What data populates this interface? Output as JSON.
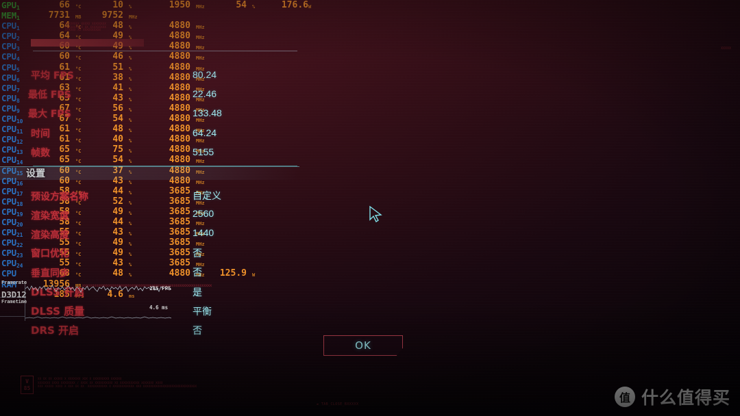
{
  "osd": {
    "rows": [
      {
        "label": "GPU",
        "sub": "1",
        "cells": [
          {
            "v": "66",
            "u": "°C"
          },
          {
            "v": "10",
            "u": "%"
          },
          {
            "v": "1950",
            "u": "MHz"
          },
          {
            "v": "54",
            "u": "%"
          },
          {
            "v": "176.6",
            "u": "W"
          }
        ]
      },
      {
        "label": "MEM",
        "sub": "1",
        "cells": [
          {
            "v": "7731",
            "u": "MB"
          },
          {
            "v": "9752",
            "u": "MHz"
          }
        ]
      },
      {
        "label": "CPU",
        "sub": "1",
        "cells": [
          {
            "v": "64",
            "u": "°C"
          },
          {
            "v": "48",
            "u": "%"
          },
          {
            "v": "4880",
            "u": "MHz"
          }
        ]
      },
      {
        "label": "CPU",
        "sub": "2",
        "cells": [
          {
            "v": "64",
            "u": "°C"
          },
          {
            "v": "49",
            "u": "%"
          },
          {
            "v": "4880",
            "u": "MHz"
          }
        ]
      },
      {
        "label": "CPU",
        "sub": "3",
        "cells": [
          {
            "v": "60",
            "u": "°C"
          },
          {
            "v": "49",
            "u": "%"
          },
          {
            "v": "4880",
            "u": "MHz"
          }
        ]
      },
      {
        "label": "CPU",
        "sub": "4",
        "cells": [
          {
            "v": "60",
            "u": "°C"
          },
          {
            "v": "46",
            "u": "%"
          },
          {
            "v": "4880",
            "u": "MHz"
          }
        ]
      },
      {
        "label": "CPU",
        "sub": "5",
        "cells": [
          {
            "v": "61",
            "u": "°C"
          },
          {
            "v": "51",
            "u": "%"
          },
          {
            "v": "4880",
            "u": "MHz"
          }
        ]
      },
      {
        "label": "CPU",
        "sub": "6",
        "cells": [
          {
            "v": "61",
            "u": "°C"
          },
          {
            "v": "38",
            "u": "%"
          },
          {
            "v": "4880",
            "u": "MHz"
          }
        ]
      },
      {
        "label": "CPU",
        "sub": "7",
        "cells": [
          {
            "v": "63",
            "u": "°C"
          },
          {
            "v": "41",
            "u": "%"
          },
          {
            "v": "4880",
            "u": "MHz"
          }
        ]
      },
      {
        "label": "CPU",
        "sub": "8",
        "cells": [
          {
            "v": "63",
            "u": "°C"
          },
          {
            "v": "43",
            "u": "%"
          },
          {
            "v": "4880",
            "u": "MHz"
          }
        ]
      },
      {
        "label": "CPU",
        "sub": "9",
        "cells": [
          {
            "v": "67",
            "u": "°C"
          },
          {
            "v": "56",
            "u": "%"
          },
          {
            "v": "4880",
            "u": "MHz"
          }
        ]
      },
      {
        "label": "CPU",
        "sub": "10",
        "cells": [
          {
            "v": "67",
            "u": "°C"
          },
          {
            "v": "54",
            "u": "%"
          },
          {
            "v": "4880",
            "u": "MHz"
          }
        ]
      },
      {
        "label": "CPU",
        "sub": "11",
        "cells": [
          {
            "v": "61",
            "u": "°C"
          },
          {
            "v": "48",
            "u": "%"
          },
          {
            "v": "4880",
            "u": "MHz"
          }
        ]
      },
      {
        "label": "CPU",
        "sub": "12",
        "cells": [
          {
            "v": "61",
            "u": "°C"
          },
          {
            "v": "40",
            "u": "%"
          },
          {
            "v": "4880",
            "u": "MHz"
          }
        ]
      },
      {
        "label": "CPU",
        "sub": "13",
        "cells": [
          {
            "v": "65",
            "u": "°C"
          },
          {
            "v": "75",
            "u": "%"
          },
          {
            "v": "4880",
            "u": "MHz"
          }
        ]
      },
      {
        "label": "CPU",
        "sub": "14",
        "cells": [
          {
            "v": "65",
            "u": "°C"
          },
          {
            "v": "54",
            "u": "%"
          },
          {
            "v": "4880",
            "u": "MHz"
          }
        ]
      },
      {
        "label": "CPU",
        "sub": "15",
        "cells": [
          {
            "v": "60",
            "u": "°C"
          },
          {
            "v": "37",
            "u": "%"
          },
          {
            "v": "4880",
            "u": "MHz"
          }
        ]
      },
      {
        "label": "CPU",
        "sub": "16",
        "cells": [
          {
            "v": "60",
            "u": "°C"
          },
          {
            "v": "43",
            "u": "%"
          },
          {
            "v": "4880",
            "u": "MHz"
          }
        ]
      },
      {
        "label": "CPU",
        "sub": "17",
        "cells": [
          {
            "v": "58",
            "u": "°C"
          },
          {
            "v": "44",
            "u": "%"
          },
          {
            "v": "3685",
            "u": "MHz"
          }
        ]
      },
      {
        "label": "CPU",
        "sub": "18",
        "cells": [
          {
            "v": "58",
            "u": "°C"
          },
          {
            "v": "52",
            "u": "%"
          },
          {
            "v": "3685",
            "u": "MHz"
          }
        ]
      },
      {
        "label": "CPU",
        "sub": "19",
        "cells": [
          {
            "v": "58",
            "u": "°C"
          },
          {
            "v": "49",
            "u": "%"
          },
          {
            "v": "3685",
            "u": "MHz"
          }
        ]
      },
      {
        "label": "CPU",
        "sub": "20",
        "cells": [
          {
            "v": "58",
            "u": "°C"
          },
          {
            "v": "44",
            "u": "%"
          },
          {
            "v": "3685",
            "u": "MHz"
          }
        ]
      },
      {
        "label": "CPU",
        "sub": "21",
        "cells": [
          {
            "v": "55",
            "u": "°C"
          },
          {
            "v": "43",
            "u": "%"
          },
          {
            "v": "3685",
            "u": "MHz"
          }
        ]
      },
      {
        "label": "CPU",
        "sub": "22",
        "cells": [
          {
            "v": "55",
            "u": "°C"
          },
          {
            "v": "49",
            "u": "%"
          },
          {
            "v": "3685",
            "u": "MHz"
          }
        ]
      },
      {
        "label": "CPU",
        "sub": "23",
        "cells": [
          {
            "v": "55",
            "u": "°C"
          },
          {
            "v": "49",
            "u": "%"
          },
          {
            "v": "3685",
            "u": "MHz"
          }
        ]
      },
      {
        "label": "CPU",
        "sub": "24",
        "cells": [
          {
            "v": "55",
            "u": "°C"
          },
          {
            "v": "43",
            "u": "%"
          },
          {
            "v": "3685",
            "u": "MHz"
          }
        ]
      },
      {
        "label": "CPU",
        "sub": "",
        "cells": [
          {
            "v": "68",
            "u": "°C"
          },
          {
            "v": "48",
            "u": "%"
          },
          {
            "v": "4880",
            "u": "MHz"
          },
          {
            "v": "125.9",
            "u": "W"
          }
        ]
      },
      {
        "label": "RAM",
        "sub": "",
        "cells": [
          {
            "v": "13956",
            "u": "MB"
          }
        ]
      },
      {
        "label": "D3D12",
        "sub": "",
        "cells": [
          {
            "v": "185",
            "u": "FPS"
          },
          {
            "v": "4.6",
            "u": "ms"
          }
        ]
      }
    ],
    "graphs": [
      {
        "title": "Framerate",
        "value": "185 FPS"
      },
      {
        "title": "Frametime",
        "value": "4.6 ms"
      }
    ]
  },
  "dialog": {
    "title": "设置",
    "labels": [
      {
        "text": "平均 FPS",
        "value": "80.24"
      },
      {
        "text": "最低 FPS",
        "value": "22.46"
      },
      {
        "text": "最大 FPS",
        "value": "133.48"
      },
      {
        "text": "时间",
        "value": "64.24"
      },
      {
        "text": "帧数",
        "value": "5155"
      },
      {
        "text": "预设方案名称",
        "value": "自定义"
      },
      {
        "text": "渲染宽度",
        "value": "2560"
      },
      {
        "text": "渲染高度",
        "value": "1440"
      },
      {
        "text": "窗口优化",
        "value": "否"
      },
      {
        "text": "垂直同步",
        "value": "否"
      },
      {
        "text": "DLSS 开启",
        "value": "是"
      },
      {
        "text": "DLSS 质量",
        "value": "平衡"
      },
      {
        "text": "DRS 开启",
        "value": "否"
      }
    ],
    "ok_button": "OK"
  },
  "version_badge": {
    "line1": "V",
    "line2": "85"
  },
  "watermark": {
    "logo": "值",
    "text": "什么值得买"
  },
  "colors": {
    "osd_label_cpu": "#2f7fd8",
    "osd_label_gpu": "#3fb93f",
    "osd_value": "#f0922a",
    "dialog_label": "#c0303a",
    "dialog_value": "#9fe8ef",
    "accent_cyan": "#9fe8ef",
    "button_border": "#b4404e",
    "background": "#3a1019"
  }
}
